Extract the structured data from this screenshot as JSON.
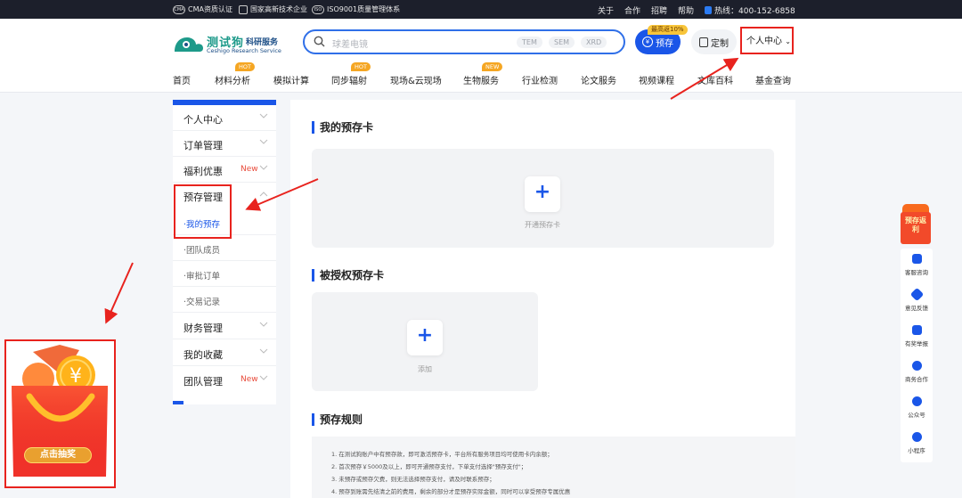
{
  "topbar": {
    "certs": [
      {
        "icon": "cma-icon",
        "icon_text": "CMA",
        "label": "CMA资质认证"
      },
      {
        "icon": "hitech-icon",
        "icon_text": "",
        "label": "国家高新技术企业"
      },
      {
        "icon": "iso-icon",
        "icon_text": "ISO",
        "label": "ISO9001质量管理体系"
      }
    ],
    "links": [
      "关于",
      "合作",
      "招聘",
      "帮助"
    ],
    "hotline": "热线：400-152-6858"
  },
  "header": {
    "logo_cn": "测试狗",
    "logo_cn2": "科研服务",
    "logo_en": "Ceshigo Research Service",
    "search_placeholder": "球差电镜",
    "search_chips": [
      "TEM",
      "SEM",
      "XRD"
    ],
    "prestore_label": "预存",
    "promo_badge": "最高返10%",
    "custom_label": "定制",
    "user_center": "个人中心"
  },
  "nav": [
    {
      "label": "首页",
      "tag": ""
    },
    {
      "label": "材料分析",
      "tag": "HOT"
    },
    {
      "label": "模拟计算",
      "tag": ""
    },
    {
      "label": "同步辐射",
      "tag": "HOT"
    },
    {
      "label": "现场&云现场",
      "tag": ""
    },
    {
      "label": "生物服务",
      "tag": "NEW"
    },
    {
      "label": "行业检测",
      "tag": ""
    },
    {
      "label": "论文服务",
      "tag": ""
    },
    {
      "label": "视频课程",
      "tag": ""
    },
    {
      "label": "文库百科",
      "tag": ""
    },
    {
      "label": "基金查询",
      "tag": ""
    }
  ],
  "sidebar": {
    "menus": {
      "personal": {
        "label": "个人中心",
        "badge": ""
      },
      "orders": {
        "label": "订单管理",
        "badge": ""
      },
      "welfare": {
        "label": "福利优惠",
        "badge": "New"
      },
      "prestore": {
        "label": "预存管理",
        "badge": ""
      },
      "finance": {
        "label": "财务管理",
        "badge": ""
      },
      "favorites": {
        "label": "我的收藏",
        "badge": ""
      },
      "team": {
        "label": "团队管理",
        "badge": "New"
      }
    },
    "subs": [
      "·我的预存",
      "·团队成员",
      "·审批订单",
      "·交易记录"
    ]
  },
  "main": {
    "my_cards_title": "我的预存卡",
    "open_card_label": "开通预存卡",
    "authorized_title": "被授权预存卡",
    "add_label": "添加",
    "rules_title": "预存规则",
    "rules": [
      "1. 在测试狗账户中有预存款，即可激活预存卡，平台所有服务项目均可使用卡内余额；",
      "2. 首次预存￥5000及以上，即可开通预存支付，下单支付选择\"预存支付\"；",
      "3. 未预存或预存欠费，则无法选择预存支付，请及时联系预存；",
      "4. 预存到账需先结清之前的费用，剩余的部分才是预存实际金额，同时可以享受预存专属优惠"
    ]
  },
  "rightbar": {
    "gift_text": "预存返利",
    "items": [
      {
        "icon": "chat-icon",
        "label": "客服咨询"
      },
      {
        "icon": "feedback-icon",
        "label": "意见反馈"
      },
      {
        "icon": "report-icon",
        "label": "有奖举报"
      },
      {
        "icon": "handshake-icon",
        "label": "商务合作"
      },
      {
        "icon": "wechat-icon",
        "label": "公众号"
      },
      {
        "icon": "miniprogram-icon",
        "label": "小程序"
      }
    ]
  },
  "lottery": {
    "button_label": "点击抽奖",
    "coin_symbol": "¥"
  },
  "colors": {
    "brand_blue": "#1a56e8",
    "topbar_bg": "#1c1f2b",
    "annotation_red": "#e8231e",
    "new_red": "#e84a3a",
    "hot_orange": "#f5a623"
  }
}
